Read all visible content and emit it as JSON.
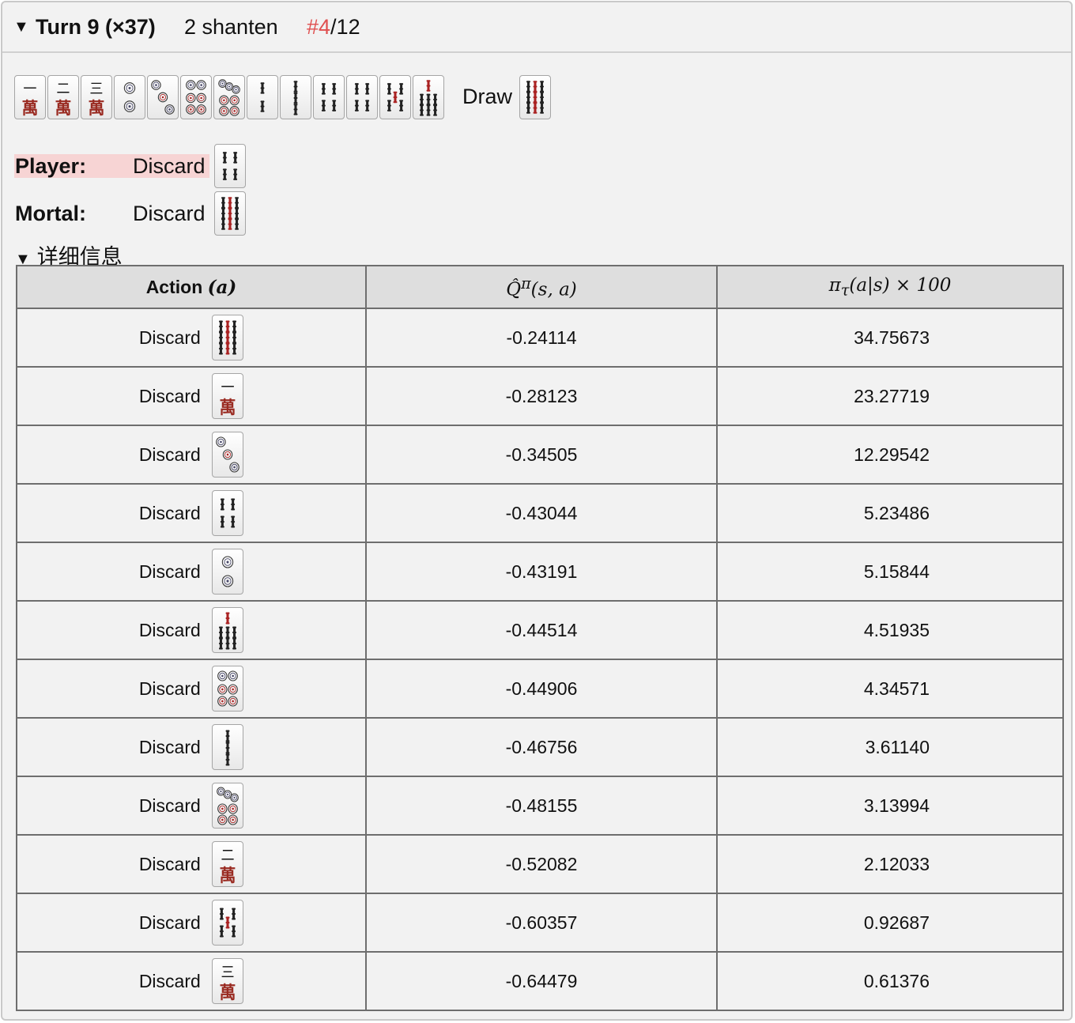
{
  "header": {
    "toggle": "▼",
    "turn": "Turn 9 (×37)",
    "shanten": "2 shanten",
    "rank_hash": "#4",
    "rank_total": "/12"
  },
  "hand": {
    "tiles": [
      "1m",
      "2m",
      "3m",
      "2p",
      "3p",
      "6p",
      "7p",
      "2s",
      "3s",
      "4s",
      "4s",
      "5s",
      "7s"
    ],
    "draw_label": "Draw",
    "draw_tile": "9s"
  },
  "player": {
    "name": "Player:",
    "action": "Discard",
    "tile": "4s"
  },
  "mortal": {
    "name": "Mortal:",
    "action": "Discard",
    "tile": "9s"
  },
  "details": {
    "toggle": "▼",
    "title": "详细信息"
  },
  "table": {
    "headers": {
      "action_text": "Action",
      "action_math": "(a)",
      "q_math": "Q̂",
      "q_sup": "π",
      "q_args": "(s, a)",
      "pi_math": "π",
      "pi_sub": "τ",
      "pi_args": "(a|s) × 100"
    },
    "rows": [
      {
        "action": "Discard",
        "tile": "9s",
        "q": "-0.24114",
        "p": "34.75673"
      },
      {
        "action": "Discard",
        "tile": "1m",
        "q": "-0.28123",
        "p": "23.27719"
      },
      {
        "action": "Discard",
        "tile": "3p",
        "q": "-0.34505",
        "p": "12.29542"
      },
      {
        "action": "Discard",
        "tile": "4s",
        "q": "-0.43044",
        "p": "5.23486"
      },
      {
        "action": "Discard",
        "tile": "2p",
        "q": "-0.43191",
        "p": "5.15844"
      },
      {
        "action": "Discard",
        "tile": "7s",
        "q": "-0.44514",
        "p": "4.51935"
      },
      {
        "action": "Discard",
        "tile": "6p",
        "q": "-0.44906",
        "p": "4.34571"
      },
      {
        "action": "Discard",
        "tile": "3s",
        "q": "-0.46756",
        "p": "3.61140"
      },
      {
        "action": "Discard",
        "tile": "7p",
        "q": "-0.48155",
        "p": "3.13994"
      },
      {
        "action": "Discard",
        "tile": "2m",
        "q": "-0.52082",
        "p": "2.12033"
      },
      {
        "action": "Discard",
        "tile": "5s",
        "q": "-0.60357",
        "p": "0.92687"
      },
      {
        "action": "Discard",
        "tile": "3m",
        "q": "-0.64479",
        "p": "0.61376"
      }
    ]
  },
  "colors": {
    "highlight": "#e05050",
    "player_bg": "#f7d4d4",
    "man_red": "#9a2b22"
  }
}
